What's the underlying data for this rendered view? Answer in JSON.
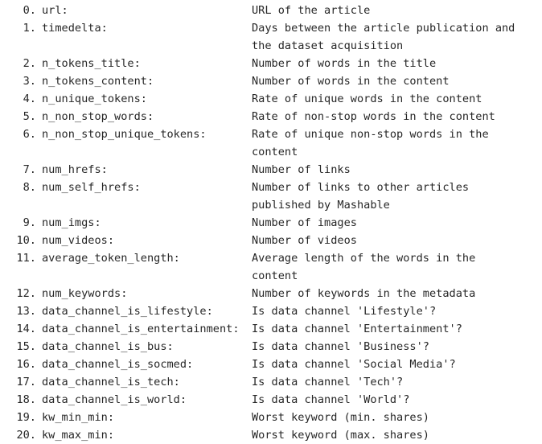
{
  "variables": [
    {
      "num": "0.",
      "name": "url:",
      "desc": [
        "URL of the article"
      ]
    },
    {
      "num": "1.",
      "name": "timedelta:",
      "desc": [
        "Days between the article publication and",
        "the dataset acquisition"
      ]
    },
    {
      "num": "2.",
      "name": "n_tokens_title:",
      "desc": [
        "Number of words in the title"
      ]
    },
    {
      "num": "3.",
      "name": "n_tokens_content:",
      "desc": [
        "Number of words in the content"
      ]
    },
    {
      "num": "4.",
      "name": "n_unique_tokens:",
      "desc": [
        "Rate of unique words in the content"
      ]
    },
    {
      "num": "5.",
      "name": "n_non_stop_words:",
      "desc": [
        "Rate of non-stop words in the content"
      ]
    },
    {
      "num": "6.",
      "name": "n_non_stop_unique_tokens:",
      "desc": [
        "Rate of unique non-stop words in the",
        "content"
      ]
    },
    {
      "num": "7.",
      "name": "num_hrefs:",
      "desc": [
        "Number of links"
      ]
    },
    {
      "num": "8.",
      "name": "num_self_hrefs:",
      "desc": [
        "Number of links to other articles",
        "published by Mashable"
      ]
    },
    {
      "num": "9.",
      "name": "num_imgs:",
      "desc": [
        "Number of images"
      ]
    },
    {
      "num": "10.",
      "name": "num_videos:",
      "desc": [
        "Number of videos"
      ]
    },
    {
      "num": "11.",
      "name": "average_token_length:",
      "desc": [
        "Average length of the words in the",
        "content"
      ]
    },
    {
      "num": "12.",
      "name": "num_keywords:",
      "desc": [
        "Number of keywords in the metadata"
      ]
    },
    {
      "num": "13.",
      "name": "data_channel_is_lifestyle:",
      "desc": [
        "Is data channel 'Lifestyle'?"
      ]
    },
    {
      "num": "14.",
      "name": "data_channel_is_entertainment:",
      "desc": [
        "Is data channel 'Entertainment'?"
      ]
    },
    {
      "num": "15.",
      "name": "data_channel_is_bus:",
      "desc": [
        "Is data channel 'Business'?"
      ]
    },
    {
      "num": "16.",
      "name": "data_channel_is_socmed:",
      "desc": [
        "Is data channel 'Social Media'?"
      ]
    },
    {
      "num": "17.",
      "name": "data_channel_is_tech:",
      "desc": [
        "Is data channel 'Tech'?"
      ]
    },
    {
      "num": "18.",
      "name": "data_channel_is_world:",
      "desc": [
        "Is data channel 'World'?"
      ]
    },
    {
      "num": "19.",
      "name": "kw_min_min:",
      "desc": [
        "Worst keyword (min. shares)"
      ]
    },
    {
      "num": "20.",
      "name": "kw_max_min:",
      "desc": [
        "Worst keyword (max. shares)"
      ]
    }
  ]
}
